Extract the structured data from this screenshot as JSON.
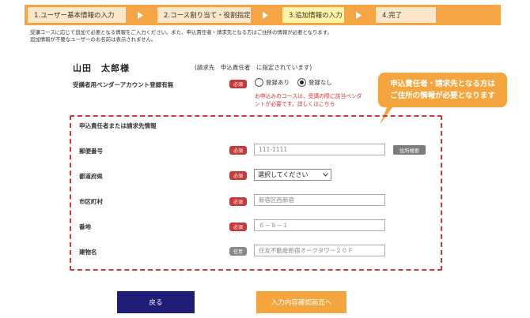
{
  "steps": [
    {
      "label": "1.ユーザー基本情報の入力",
      "active": false
    },
    {
      "label": "2.コース割り当て・役割指定",
      "active": false
    },
    {
      "label": "3.追加情報の入力",
      "active": true
    },
    {
      "label": "4.完了",
      "active": false
    }
  ],
  "intro": {
    "line1": "受講コースに応じて追加で必要となる情報をご入力ください。また、申込責任者・請求先となる方はご住所の情報が必要となります。",
    "line2": "追加情報が不要なユーザーのお名前は表示されません。"
  },
  "user": {
    "name": "山田　太郎様",
    "note": "(請求先　申込責任者　に指定されています)"
  },
  "vendor_account": {
    "label": "受講者用ベンダーアカウント登録有無",
    "badge": "必須",
    "options": [
      "登録あり",
      "登録なし"
    ],
    "selected": "登録なし",
    "warning_line1": "お申込みのコースは、受講の際に該当ベンダ",
    "warning_line2": "ントが必要です。詳しくはこちら"
  },
  "callout": {
    "line1": "申込責任者・請求先となる方は",
    "line2": "ご住所の情報が必要となります"
  },
  "address": {
    "title": "申込責任者または請求先情報",
    "postal": {
      "label": "郵便番号",
      "badge": "必須",
      "value": "111-1111",
      "button": "住所検索"
    },
    "prefecture": {
      "label": "都道府県",
      "badge": "必須",
      "value": "選択してください"
    },
    "city": {
      "label": "市区町村",
      "badge": "必須",
      "value": "新宿区西新宿"
    },
    "street": {
      "label": "番地",
      "badge": "必須",
      "value": "６－８－１"
    },
    "building": {
      "label": "建物名",
      "badge": "任意",
      "value": "住友不動産新宿オークタワー２０Ｆ"
    }
  },
  "buttons": {
    "back": "戻る",
    "next": "入力内容確認画面へ"
  },
  "colors": {
    "orange": "#f6a545",
    "step_inactive": "#fbe6c9",
    "step_active": "#fff3a8",
    "required_badge": "#c23a3a",
    "dashed_border": "#d23838",
    "navy_button": "#1f1d78"
  }
}
